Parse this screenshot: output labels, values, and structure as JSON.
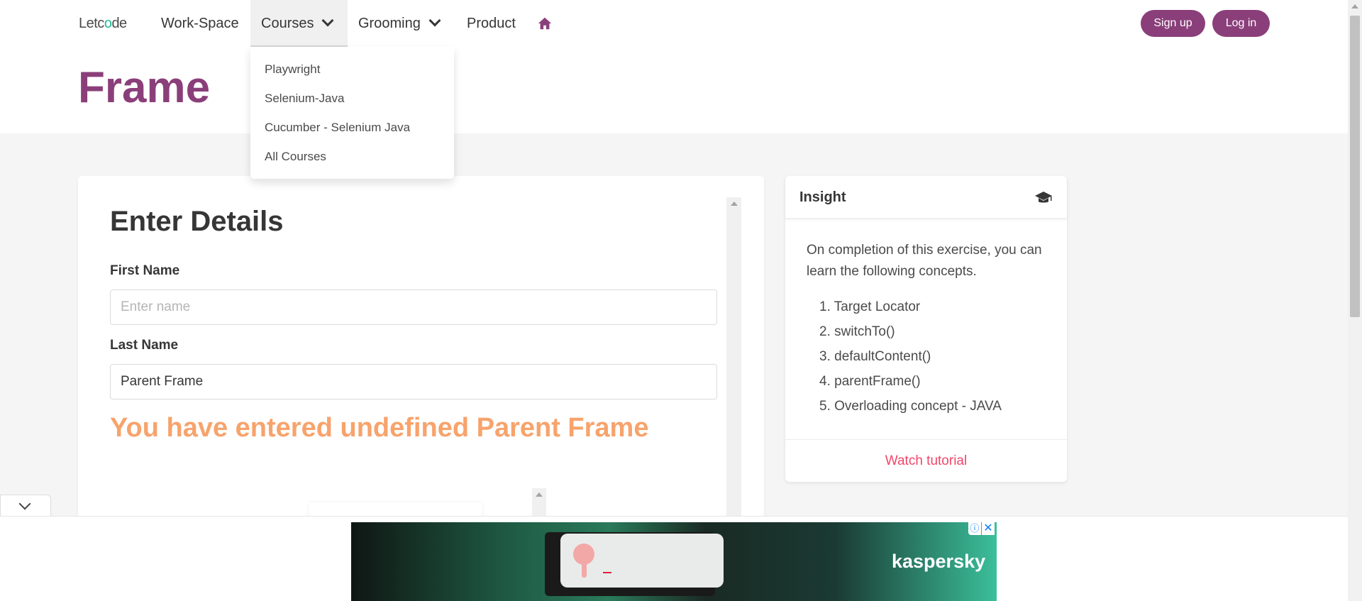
{
  "nav": {
    "logo_prefix": "Letc",
    "logo_o": "o",
    "logo_suffix": "de",
    "items": [
      {
        "label": "Work-Space"
      },
      {
        "label": "Courses"
      },
      {
        "label": "Grooming"
      },
      {
        "label": "Product"
      }
    ],
    "home_icon": "home-icon",
    "signup_label": "Sign up",
    "login_label": "Log in"
  },
  "courses_dropdown": {
    "items": [
      "Playwright",
      "Selenium-Java",
      "Cucumber - Selenium Java",
      "All Courses"
    ]
  },
  "page": {
    "title": "Frame"
  },
  "form": {
    "title": "Enter Details",
    "first_name_label": "First Name",
    "first_name_placeholder": "Enter name",
    "first_name_value": "",
    "last_name_label": "Last Name",
    "last_name_value": "Parent Frame",
    "result": "You have entered undefined Parent Frame"
  },
  "insight": {
    "title": "Insight",
    "icon": "graduation-cap-icon",
    "description": "On completion of this exercise, you can learn the following concepts.",
    "concepts": [
      "1. Target Locator",
      "2. switchTo()",
      "3. defaultContent()",
      "4. parentFrame()",
      "5. Overloading concept - JAVA"
    ],
    "footer_link": "Watch tutorial"
  },
  "ad": {
    "brand": "kaspersky",
    "info_icon": "ⓘ",
    "close_icon": "✕"
  },
  "colors": {
    "brand": "#8a3f7a",
    "result": "#f7a36c",
    "link": "#f14668"
  }
}
